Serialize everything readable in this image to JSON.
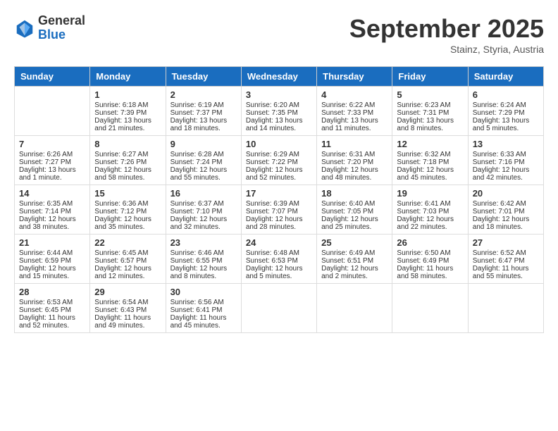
{
  "header": {
    "logo": {
      "general": "General",
      "blue": "Blue"
    },
    "title": "September 2025",
    "location": "Stainz, Styria, Austria"
  },
  "weekdays": [
    "Sunday",
    "Monday",
    "Tuesday",
    "Wednesday",
    "Thursday",
    "Friday",
    "Saturday"
  ],
  "weeks": [
    [
      {
        "day": "",
        "sunrise": "",
        "sunset": "",
        "daylight": "",
        "empty": true
      },
      {
        "day": "1",
        "sunrise": "Sunrise: 6:18 AM",
        "sunset": "Sunset: 7:39 PM",
        "daylight": "Daylight: 13 hours and 21 minutes."
      },
      {
        "day": "2",
        "sunrise": "Sunrise: 6:19 AM",
        "sunset": "Sunset: 7:37 PM",
        "daylight": "Daylight: 13 hours and 18 minutes."
      },
      {
        "day": "3",
        "sunrise": "Sunrise: 6:20 AM",
        "sunset": "Sunset: 7:35 PM",
        "daylight": "Daylight: 13 hours and 14 minutes."
      },
      {
        "day": "4",
        "sunrise": "Sunrise: 6:22 AM",
        "sunset": "Sunset: 7:33 PM",
        "daylight": "Daylight: 13 hours and 11 minutes."
      },
      {
        "day": "5",
        "sunrise": "Sunrise: 6:23 AM",
        "sunset": "Sunset: 7:31 PM",
        "daylight": "Daylight: 13 hours and 8 minutes."
      },
      {
        "day": "6",
        "sunrise": "Sunrise: 6:24 AM",
        "sunset": "Sunset: 7:29 PM",
        "daylight": "Daylight: 13 hours and 5 minutes."
      }
    ],
    [
      {
        "day": "7",
        "sunrise": "Sunrise: 6:26 AM",
        "sunset": "Sunset: 7:27 PM",
        "daylight": "Daylight: 13 hours and 1 minute."
      },
      {
        "day": "8",
        "sunrise": "Sunrise: 6:27 AM",
        "sunset": "Sunset: 7:26 PM",
        "daylight": "Daylight: 12 hours and 58 minutes."
      },
      {
        "day": "9",
        "sunrise": "Sunrise: 6:28 AM",
        "sunset": "Sunset: 7:24 PM",
        "daylight": "Daylight: 12 hours and 55 minutes."
      },
      {
        "day": "10",
        "sunrise": "Sunrise: 6:29 AM",
        "sunset": "Sunset: 7:22 PM",
        "daylight": "Daylight: 12 hours and 52 minutes."
      },
      {
        "day": "11",
        "sunrise": "Sunrise: 6:31 AM",
        "sunset": "Sunset: 7:20 PM",
        "daylight": "Daylight: 12 hours and 48 minutes."
      },
      {
        "day": "12",
        "sunrise": "Sunrise: 6:32 AM",
        "sunset": "Sunset: 7:18 PM",
        "daylight": "Daylight: 12 hours and 45 minutes."
      },
      {
        "day": "13",
        "sunrise": "Sunrise: 6:33 AM",
        "sunset": "Sunset: 7:16 PM",
        "daylight": "Daylight: 12 hours and 42 minutes."
      }
    ],
    [
      {
        "day": "14",
        "sunrise": "Sunrise: 6:35 AM",
        "sunset": "Sunset: 7:14 PM",
        "daylight": "Daylight: 12 hours and 38 minutes."
      },
      {
        "day": "15",
        "sunrise": "Sunrise: 6:36 AM",
        "sunset": "Sunset: 7:12 PM",
        "daylight": "Daylight: 12 hours and 35 minutes."
      },
      {
        "day": "16",
        "sunrise": "Sunrise: 6:37 AM",
        "sunset": "Sunset: 7:10 PM",
        "daylight": "Daylight: 12 hours and 32 minutes."
      },
      {
        "day": "17",
        "sunrise": "Sunrise: 6:39 AM",
        "sunset": "Sunset: 7:07 PM",
        "daylight": "Daylight: 12 hours and 28 minutes."
      },
      {
        "day": "18",
        "sunrise": "Sunrise: 6:40 AM",
        "sunset": "Sunset: 7:05 PM",
        "daylight": "Daylight: 12 hours and 25 minutes."
      },
      {
        "day": "19",
        "sunrise": "Sunrise: 6:41 AM",
        "sunset": "Sunset: 7:03 PM",
        "daylight": "Daylight: 12 hours and 22 minutes."
      },
      {
        "day": "20",
        "sunrise": "Sunrise: 6:42 AM",
        "sunset": "Sunset: 7:01 PM",
        "daylight": "Daylight: 12 hours and 18 minutes."
      }
    ],
    [
      {
        "day": "21",
        "sunrise": "Sunrise: 6:44 AM",
        "sunset": "Sunset: 6:59 PM",
        "daylight": "Daylight: 12 hours and 15 minutes."
      },
      {
        "day": "22",
        "sunrise": "Sunrise: 6:45 AM",
        "sunset": "Sunset: 6:57 PM",
        "daylight": "Daylight: 12 hours and 12 minutes."
      },
      {
        "day": "23",
        "sunrise": "Sunrise: 6:46 AM",
        "sunset": "Sunset: 6:55 PM",
        "daylight": "Daylight: 12 hours and 8 minutes."
      },
      {
        "day": "24",
        "sunrise": "Sunrise: 6:48 AM",
        "sunset": "Sunset: 6:53 PM",
        "daylight": "Daylight: 12 hours and 5 minutes."
      },
      {
        "day": "25",
        "sunrise": "Sunrise: 6:49 AM",
        "sunset": "Sunset: 6:51 PM",
        "daylight": "Daylight: 12 hours and 2 minutes."
      },
      {
        "day": "26",
        "sunrise": "Sunrise: 6:50 AM",
        "sunset": "Sunset: 6:49 PM",
        "daylight": "Daylight: 11 hours and 58 minutes."
      },
      {
        "day": "27",
        "sunrise": "Sunrise: 6:52 AM",
        "sunset": "Sunset: 6:47 PM",
        "daylight": "Daylight: 11 hours and 55 minutes."
      }
    ],
    [
      {
        "day": "28",
        "sunrise": "Sunrise: 6:53 AM",
        "sunset": "Sunset: 6:45 PM",
        "daylight": "Daylight: 11 hours and 52 minutes."
      },
      {
        "day": "29",
        "sunrise": "Sunrise: 6:54 AM",
        "sunset": "Sunset: 6:43 PM",
        "daylight": "Daylight: 11 hours and 49 minutes."
      },
      {
        "day": "30",
        "sunrise": "Sunrise: 6:56 AM",
        "sunset": "Sunset: 6:41 PM",
        "daylight": "Daylight: 11 hours and 45 minutes."
      },
      {
        "day": "",
        "sunrise": "",
        "sunset": "",
        "daylight": "",
        "empty": true
      },
      {
        "day": "",
        "sunrise": "",
        "sunset": "",
        "daylight": "",
        "empty": true
      },
      {
        "day": "",
        "sunrise": "",
        "sunset": "",
        "daylight": "",
        "empty": true
      },
      {
        "day": "",
        "sunrise": "",
        "sunset": "",
        "daylight": "",
        "empty": true
      }
    ]
  ]
}
